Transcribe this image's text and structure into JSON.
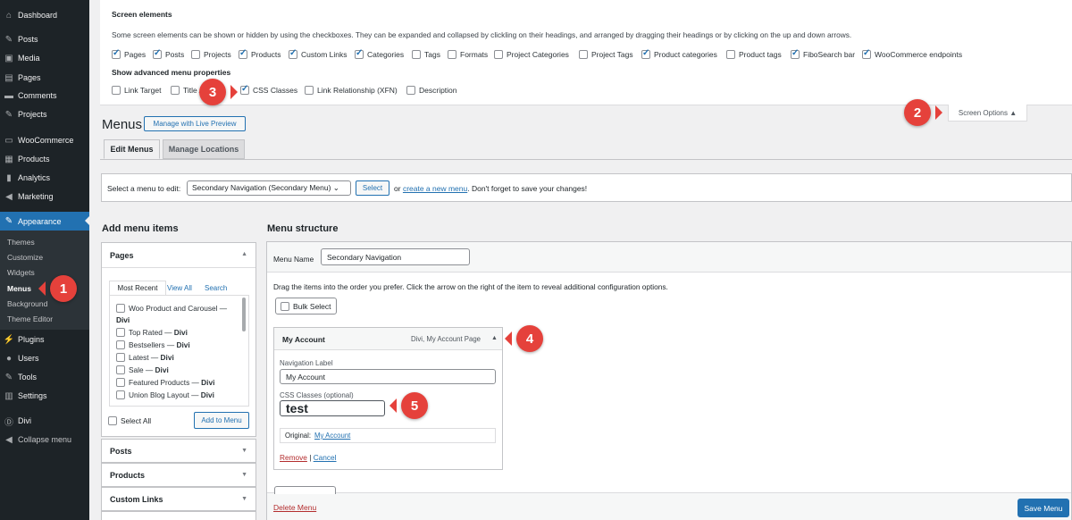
{
  "sidebar": {
    "items": [
      {
        "label": "Dashboard",
        "icon": "dashboard-icon",
        "glyph": "⌂"
      },
      {
        "label": "Posts",
        "icon": "pin-icon",
        "glyph": "✎"
      },
      {
        "label": "Media",
        "icon": "media-icon",
        "glyph": "▣"
      },
      {
        "label": "Pages",
        "icon": "pages-icon",
        "glyph": "▤"
      },
      {
        "label": "Comments",
        "icon": "comments-icon",
        "glyph": "▬"
      },
      {
        "label": "Projects",
        "icon": "pin-icon",
        "glyph": "✎"
      },
      {
        "label": "WooCommerce",
        "icon": "woo-icon",
        "glyph": "▭"
      },
      {
        "label": "Products",
        "icon": "products-icon",
        "glyph": "▦"
      },
      {
        "label": "Analytics",
        "icon": "analytics-icon",
        "glyph": "▮"
      },
      {
        "label": "Marketing",
        "icon": "megaphone-icon",
        "glyph": "◀"
      },
      {
        "label": "Appearance",
        "icon": "brush-icon",
        "glyph": "✎"
      },
      {
        "label": "Plugins",
        "icon": "plugin-icon",
        "glyph": "⚡"
      },
      {
        "label": "Users",
        "icon": "user-icon",
        "glyph": "●"
      },
      {
        "label": "Tools",
        "icon": "wrench-icon",
        "glyph": "✎"
      },
      {
        "label": "Settings",
        "icon": "settings-icon",
        "glyph": "▥"
      },
      {
        "label": "Divi",
        "icon": "divi-icon",
        "glyph": "Ⓓ"
      },
      {
        "label": "Collapse menu",
        "icon": "collapse-icon",
        "glyph": "◀"
      }
    ],
    "submenu": [
      "Themes",
      "Customize",
      "Widgets",
      "Menus",
      "Background",
      "Theme Editor"
    ]
  },
  "screen_options": {
    "title": "Screen elements",
    "description": "Some screen elements can be shown or hidden by using the checkboxes. They can be expanded and collapsed by clickling on their headings, and arranged by dragging their headings or by clicking on the up and down arrows.",
    "boxes": [
      {
        "label": "Pages",
        "checked": true
      },
      {
        "label": "Posts",
        "checked": true
      },
      {
        "label": "Projects",
        "checked": false
      },
      {
        "label": "Products",
        "checked": true
      },
      {
        "label": "Custom Links",
        "checked": true
      },
      {
        "label": "Categories",
        "checked": true
      },
      {
        "label": "Tags",
        "checked": false
      },
      {
        "label": "Formats",
        "checked": false
      },
      {
        "label": "Project Categories",
        "checked": false
      },
      {
        "label": "Project Tags",
        "checked": false
      },
      {
        "label": "Product categories",
        "checked": true
      },
      {
        "label": "Product tags",
        "checked": false
      },
      {
        "label": "FiboSearch bar",
        "checked": true
      },
      {
        "label": "WooCommerce endpoints",
        "checked": true
      }
    ],
    "advanced_title": "Show advanced menu properties",
    "advanced": [
      {
        "label": "Link Target",
        "checked": false
      },
      {
        "label": "Title Attribute",
        "checked": false
      },
      {
        "label": "CSS Classes",
        "checked": true
      },
      {
        "label": "Link Relationship (XFN)",
        "checked": false
      },
      {
        "label": "Description",
        "checked": false
      }
    ],
    "toggle_label": "Screen Options ▲"
  },
  "header": {
    "title": "Menus",
    "live_preview": "Manage with Live Preview"
  },
  "tabs": [
    "Edit Menus",
    "Manage Locations"
  ],
  "manage": {
    "label": "Select a menu to edit:",
    "selected": "Secondary Navigation (Secondary Menu) ⌄",
    "select_btn": "Select",
    "or": "or",
    "create_link": "create a new menu",
    "tail": ". Don't forget to save your changes!"
  },
  "add_items": {
    "title": "Add menu items",
    "pages_title": "Pages",
    "tabs": [
      "Most Recent",
      "View All",
      "Search"
    ],
    "pages": [
      {
        "label": "Woo Product and Carousel —",
        "bold": "Divi"
      },
      {
        "label": "Top Rated —",
        "bold": "Divi"
      },
      {
        "label": "Bestsellers —",
        "bold": "Divi"
      },
      {
        "label": "Latest —",
        "bold": "Divi"
      },
      {
        "label": "Sale —",
        "bold": "Divi"
      },
      {
        "label": "Featured Products —",
        "bold": "Divi"
      },
      {
        "label": "Union Blog Layout —",
        "bold": "Divi"
      }
    ],
    "select_all": "Select All",
    "add_btn": "Add to Menu",
    "sections": [
      "Posts",
      "Products",
      "Custom Links"
    ]
  },
  "structure": {
    "title": "Menu structure",
    "menu_name_label": "Menu Name",
    "menu_name": "Secondary Navigation",
    "hint": "Drag the items into the order you prefer. Click the arrow on the right of the item to reveal additional configuration options.",
    "bulk_select": "Bulk Select",
    "item": {
      "title": "My Account",
      "meta": "Divi, My Account Page",
      "nav_label": "Navigation Label",
      "nav_value": "My Account",
      "css_label": "CSS Classes (optional)",
      "css_value": "test",
      "original_label": "Original:",
      "original_link": "My Account",
      "remove": "Remove",
      "sep": "|",
      "cancel": "Cancel"
    },
    "delete": "Delete Menu",
    "save": "Save Menu"
  },
  "callouts": [
    "1",
    "2",
    "3",
    "4",
    "5"
  ]
}
